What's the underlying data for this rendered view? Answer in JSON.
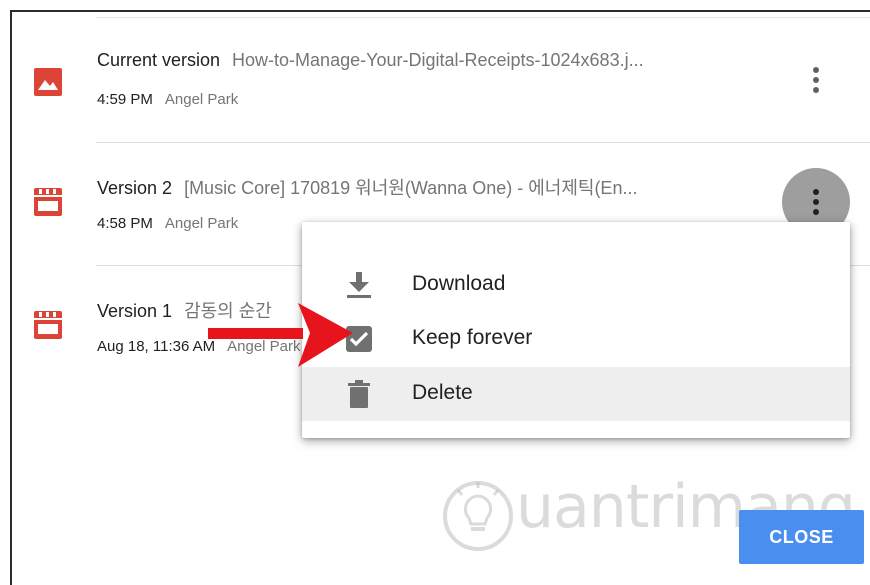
{
  "versions": [
    {
      "label": "Current version",
      "filename": "How-to-Manage-Your-Digital-Receipts-1024x683.j...",
      "time": "4:59 PM",
      "author": "Angel Park",
      "icon": "image-file-icon"
    },
    {
      "label": "Version 2",
      "filename": "[Music Core] 170819 워너원(Wanna One) - 에너제틱(En...",
      "time": "4:58 PM",
      "author": "Angel Park",
      "icon": "video-file-icon"
    },
    {
      "label": "Version 1",
      "filename": "감동의 순간",
      "time": "Aug 18, 11:36 AM",
      "author": "Angel Park",
      "icon": "video-file-icon"
    }
  ],
  "menu": {
    "items": [
      {
        "label": "Download",
        "icon": "download-icon"
      },
      {
        "label": "Keep forever",
        "icon": "checkbox-checked-icon"
      },
      {
        "label": "Delete",
        "icon": "trash-icon"
      }
    ],
    "highlighted_item": "Delete"
  },
  "close_label": "CLOSE",
  "watermark": {
    "text": "uantrimang"
  },
  "colors": {
    "file_icon_red": "#db4437",
    "close_button_blue": "#4a8ef0",
    "annotation_arrow_red": "#e8141c",
    "menu_icon_gray": "#707070"
  }
}
